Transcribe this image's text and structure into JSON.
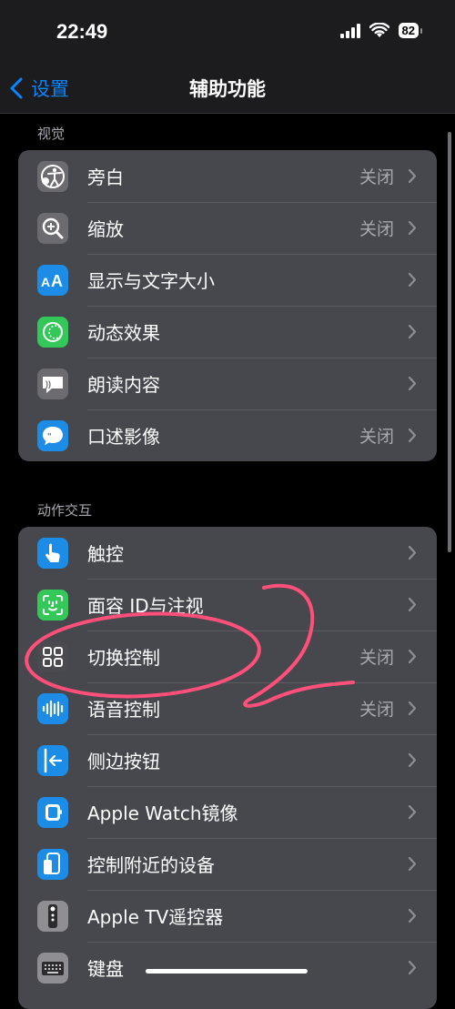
{
  "status": {
    "time": "22:49",
    "battery": "82"
  },
  "nav": {
    "back_label": "设置",
    "title": "辅助功能"
  },
  "sections": [
    {
      "header": "视觉",
      "items": [
        {
          "label": "旁白",
          "value": "关闭",
          "icon": "voiceover-icon",
          "icon_color": "#6b6b70"
        },
        {
          "label": "缩放",
          "value": "关闭",
          "icon": "zoom-icon",
          "icon_color": "#6b6b70"
        },
        {
          "label": "显示与文字大小",
          "value": "",
          "icon": "text-size-icon",
          "icon_color": "#1c8ce6"
        },
        {
          "label": "动态效果",
          "value": "",
          "icon": "motion-icon",
          "icon_color": "#34c759"
        },
        {
          "label": "朗读内容",
          "value": "",
          "icon": "spoken-content-icon",
          "icon_color": "#6b6b70"
        },
        {
          "label": "口述影像",
          "value": "关闭",
          "icon": "audio-description-icon",
          "icon_color": "#1c8ce6"
        }
      ]
    },
    {
      "header": "动作交互",
      "items": [
        {
          "label": "触控",
          "value": "",
          "icon": "touch-icon",
          "icon_color": "#1c8ce6"
        },
        {
          "label": "面容 ID与注视",
          "value": "",
          "icon": "face-id-icon",
          "icon_color": "#34c759"
        },
        {
          "label": "切换控制",
          "value": "关闭",
          "icon": "switch-control-icon",
          "icon_color": "#4a4a4f"
        },
        {
          "label": "语音控制",
          "value": "关闭",
          "icon": "voice-control-icon",
          "icon_color": "#1c8ce6"
        },
        {
          "label": "侧边按钮",
          "value": "",
          "icon": "side-button-icon",
          "icon_color": "#1c8ce6"
        },
        {
          "label": "Apple Watch镜像",
          "value": "",
          "icon": "watch-mirroring-icon",
          "icon_color": "#1c8ce6"
        },
        {
          "label": "控制附近的设备",
          "value": "",
          "icon": "nearby-devices-icon",
          "icon_color": "#1c8ce6"
        },
        {
          "label": "Apple TV遥控器",
          "value": "",
          "icon": "tv-remote-icon",
          "icon_color": "#8e8e93"
        },
        {
          "label": "键盘",
          "value": "",
          "icon": "keyboard-icon",
          "icon_color": "#8e8e93"
        }
      ]
    }
  ],
  "colors": {
    "accent": "#0a84ff",
    "annotation": "#ff4f7a"
  }
}
